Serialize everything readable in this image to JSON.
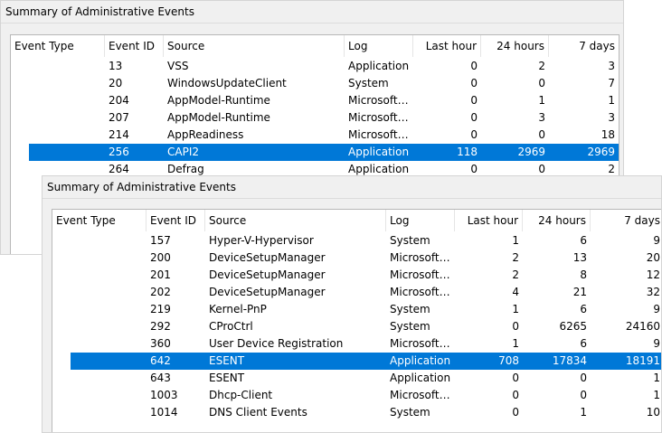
{
  "panel1": {
    "title": "Summary of Administrative Events",
    "columns": [
      "Event Type",
      "Event ID",
      "Source",
      "Log",
      "Last hour",
      "24 hours",
      "7 days"
    ],
    "rows": [
      {
        "id": "13",
        "source": "VSS",
        "log": "Application",
        "last": "0",
        "d24": "2",
        "d7": "3"
      },
      {
        "id": "20",
        "source": "WindowsUpdateClient",
        "log": "System",
        "last": "0",
        "d24": "0",
        "d7": "7"
      },
      {
        "id": "204",
        "source": "AppModel-Runtime",
        "log": "Microsoft…",
        "last": "0",
        "d24": "1",
        "d7": "1"
      },
      {
        "id": "207",
        "source": "AppModel-Runtime",
        "log": "Microsoft…",
        "last": "0",
        "d24": "3",
        "d7": "3"
      },
      {
        "id": "214",
        "source": "AppReadiness",
        "log": "Microsoft…",
        "last": "0",
        "d24": "0",
        "d7": "18"
      },
      {
        "id": "256",
        "source": "CAPI2",
        "log": "Application",
        "last": "118",
        "d24": "2969",
        "d7": "2969",
        "selected": true
      },
      {
        "id": "264",
        "source": "Defrag",
        "log": "Application",
        "last": "0",
        "d24": "0",
        "d7": "2"
      }
    ]
  },
  "panel2": {
    "title": "Summary of Administrative Events",
    "columns": [
      "Event Type",
      "Event ID",
      "Source",
      "Log",
      "Last hour",
      "24 hours",
      "7 days"
    ],
    "rows": [
      {
        "id": "157",
        "source": "Hyper-V-Hypervisor",
        "log": "System",
        "last": "1",
        "d24": "6",
        "d7": "9"
      },
      {
        "id": "200",
        "source": "DeviceSetupManager",
        "log": "Microsoft…",
        "last": "2",
        "d24": "13",
        "d7": "20"
      },
      {
        "id": "201",
        "source": "DeviceSetupManager",
        "log": "Microsoft…",
        "last": "2",
        "d24": "8",
        "d7": "12"
      },
      {
        "id": "202",
        "source": "DeviceSetupManager",
        "log": "Microsoft…",
        "last": "4",
        "d24": "21",
        "d7": "32"
      },
      {
        "id": "219",
        "source": "Kernel-PnP",
        "log": "System",
        "last": "1",
        "d24": "6",
        "d7": "9"
      },
      {
        "id": "292",
        "source": "CProCtrl",
        "log": "System",
        "last": "0",
        "d24": "6265",
        "d7": "24160"
      },
      {
        "id": "360",
        "source": "User Device Registration",
        "log": "Microsoft…",
        "last": "1",
        "d24": "6",
        "d7": "9"
      },
      {
        "id": "642",
        "source": "ESENT",
        "log": "Application",
        "last": "708",
        "d24": "17834",
        "d7": "18191",
        "selected": true
      },
      {
        "id": "643",
        "source": "ESENT",
        "log": "Application",
        "last": "0",
        "d24": "0",
        "d7": "1"
      },
      {
        "id": "1003",
        "source": "Dhcp-Client",
        "log": "Microsoft…",
        "last": "0",
        "d24": "0",
        "d7": "1"
      },
      {
        "id": "1014",
        "source": "DNS Client Events",
        "log": "System",
        "last": "0",
        "d24": "1",
        "d7": "10"
      }
    ]
  }
}
